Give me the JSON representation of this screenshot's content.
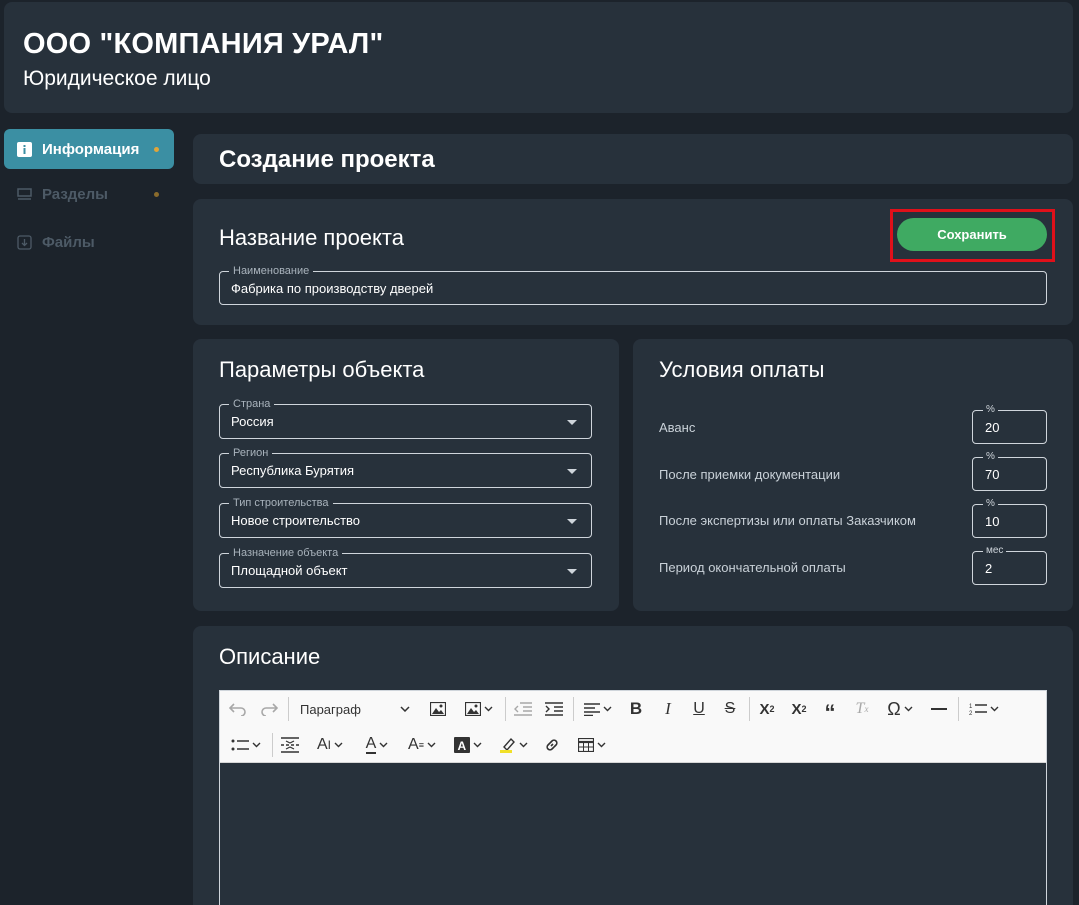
{
  "header": {
    "company_name": "ООО \"КОМПАНИЯ УРАЛ\"",
    "company_type": "Юридическое лицо"
  },
  "sidebar": {
    "items": [
      {
        "label": "Информация",
        "icon": "info-icon",
        "active": true
      },
      {
        "label": "Разделы",
        "icon": "sections-icon",
        "active": false
      },
      {
        "label": "Файлы",
        "icon": "download-icon",
        "active": false
      }
    ]
  },
  "page": {
    "title": "Создание проекта"
  },
  "project": {
    "section_title": "Название проекта",
    "save_label": "Сохранить",
    "name_legend": "Наименование",
    "name_value": "Фабрика по производству дверей"
  },
  "params": {
    "section_title": "Параметры объекта",
    "country": {
      "legend": "Страна",
      "value": "Россия"
    },
    "region": {
      "legend": "Регион",
      "value": "Республика Бурятия"
    },
    "construction_type": {
      "legend": "Тип строительства",
      "value": "Новое строительство"
    },
    "purpose": {
      "legend": "Назначение объекта",
      "value": "Площадной объект"
    }
  },
  "payment": {
    "section_title": "Условия оплаты",
    "rows": [
      {
        "label": "Аванс",
        "unit": "%",
        "value": "20"
      },
      {
        "label": "После приемки документации",
        "unit": "%",
        "value": "70"
      },
      {
        "label": "После экспертизы или оплаты Заказчиком",
        "unit": "%",
        "value": "10"
      },
      {
        "label": "Период окончательной оплаты",
        "unit": "мес",
        "value": "2"
      }
    ]
  },
  "description": {
    "section_title": "Описание",
    "paragraph_select": "Параграф"
  },
  "colors": {
    "background": "#1c232b",
    "card": "#27313b",
    "accent": "#3b8fa3",
    "save": "#3faa62",
    "highlight": "#e0101a",
    "dot": "#e0a53a"
  }
}
